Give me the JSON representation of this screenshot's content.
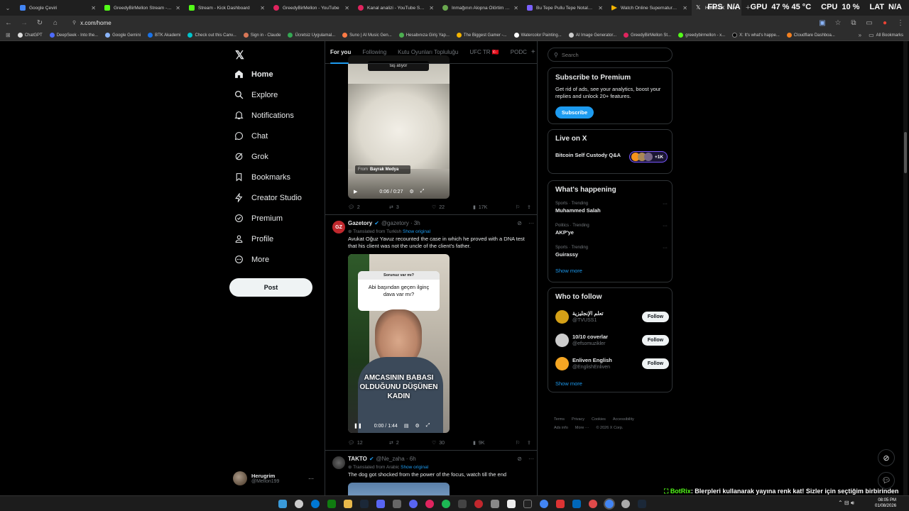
{
  "browser": {
    "tabs": [
      {
        "label": "Google Çeviri",
        "color": "#4285f4"
      },
      {
        "label": "GreedyBirMellon Stream - Watc",
        "color": "#53fc18"
      },
      {
        "label": "Stream - Kick Dashboard",
        "color": "#53fc18"
      },
      {
        "label": "GreedyBirMellon - YouTube",
        "color": "#e0245e"
      },
      {
        "label": "Kanal analizi - YouTube Studio",
        "color": "#e0245e"
      },
      {
        "label": "Inmağının Alopna Ölörtim Türk",
        "color": "#6aa84f"
      },
      {
        "label": "Bu Tepe Pullu Tepe Notaları | N",
        "color": "#7b61ff"
      },
      {
        "label": "Watch Online Supernatural Sea",
        "color": "#f4b400"
      },
      {
        "label": "Home / X",
        "color": "#000000"
      }
    ],
    "url": "x.com/home",
    "bookmarks": [
      "ChatGPT",
      "DeepSeek - Into the...",
      "Google Gemini",
      "BTK Akademi",
      "Check out this Canv...",
      "Sign in - Claude",
      "Ücretsiz Uygulamal...",
      "Suno | AI Music Gen...",
      "Hesabınıza Giriş Yap...",
      "The Biggest Gamer -...",
      "Watercolor Painting...",
      "AI Image Generator...",
      "GreedyBirMellon St...",
      "greedybirmellon - x...",
      "X: It's what's happe...",
      "Cloudflare Dashboa..."
    ],
    "all_bookmarks": "All Bookmarks"
  },
  "hud": {
    "fps_label": "FPS",
    "fps": "N/A",
    "gpu_label": "GPU",
    "gpu": "47 %  45 °C",
    "cpu_label": "CPU",
    "cpu": "10 %",
    "lat_label": "LAT",
    "lat": "N/A"
  },
  "nav": {
    "items": [
      "Home",
      "Explore",
      "Notifications",
      "Chat",
      "Grok",
      "Bookmarks",
      "Creator Studio",
      "Premium",
      "Profile",
      "More"
    ],
    "post": "Post",
    "user_name": "Herugrim",
    "user_handle": "@Mellon199"
  },
  "feed": {
    "tabs": [
      "For you",
      "Following",
      "Kutu Oyunları Topluluğu",
      "UFC TR 🇹🇷",
      "PODC"
    ],
    "tweet0": {
      "caption_top": "taş atıyor",
      "from_label": "From",
      "from_source": "Bayrak Medya",
      "time": "0:06 / 0:27",
      "replies": "2",
      "reposts": "3",
      "likes": "22",
      "views": "17K"
    },
    "tweet1": {
      "name": "Gazetory",
      "handle": "@gazetory · 3h",
      "translated": "Translated from Turkish",
      "show_original": "Show original",
      "text": "Avukat Oğuz Yavuz recounted the case in which he proved with a DNA test that his client was not the uncle of the client's father.",
      "q_small": "Sorunuz var mı?",
      "q_text": "Abi başından geçen ilginç dava var mı?",
      "overlay": "AMCASININ BABASI OLDUĞUNU DÜŞÜNEN KADIN",
      "time": "0:00 / 1:44",
      "replies": "12",
      "reposts": "2",
      "likes": "30",
      "views": "9K"
    },
    "tweet2": {
      "name": "TAKTO",
      "handle": "@Ne_zaha · 6h",
      "translated": "Translated from Arabic",
      "show_original": "Show original",
      "text": "The dog got shocked from the power of the focus, watch till the end"
    }
  },
  "right": {
    "search_placeholder": "Search",
    "premium": {
      "title": "Subscribe to Premium",
      "text": "Get rid of ads, see your analytics, boost your replies and unlock 20+ features.",
      "button": "Subscribe"
    },
    "live": {
      "title": "Live on X",
      "item": "Bitcoin Self Custody Q&A",
      "count": "+1K"
    },
    "happening": {
      "title": "What's happening",
      "trends": [
        {
          "meta": "Sports · Trending",
          "name": "Muhammed Salah"
        },
        {
          "meta": "Politics · Trending",
          "name": "AKP'ye"
        },
        {
          "meta": "Sports · Trending",
          "name": "Guirassy"
        }
      ],
      "show_more": "Show more"
    },
    "follow": {
      "title": "Who to follow",
      "users": [
        {
          "name": "تعلم الإنجليزية",
          "handle": "@TVUSS1",
          "color": "#d4a017"
        },
        {
          "name": "10/10 coverlar",
          "handle": "@efsomuzikler",
          "color": "#cccccc"
        },
        {
          "name": "Enliven English",
          "handle": "@EnglishEnliven",
          "color": "#f5a623"
        }
      ],
      "button": "Follow",
      "show_more": "Show more"
    },
    "footer": {
      "line1": [
        "Terms",
        "Privacy",
        "Cookies",
        "Accessibility"
      ],
      "line2": [
        "Ads info",
        "More ···",
        "© 2026 X Corp."
      ]
    }
  },
  "overlay_chat": {
    "user": "BotRix",
    "message": ": Blerpleri kullanarak yayına renk kat! Sizler için seçtiğim birbirinden güzel Blerpleri kullanmak için küçük harflerle \"!blerp\" yazman yeterli."
  },
  "taskbar": {
    "time": "08:05 PM",
    "date": "01/08/2026"
  }
}
